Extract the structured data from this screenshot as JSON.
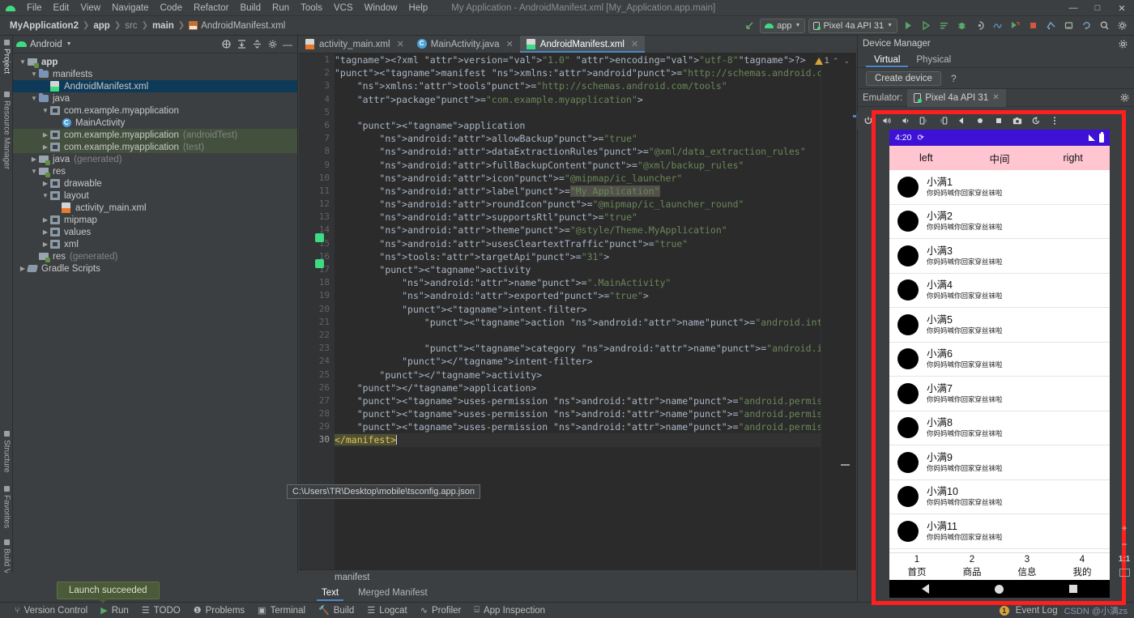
{
  "menubar": {
    "logo": "android-logo-icon",
    "items": [
      "File",
      "Edit",
      "View",
      "Navigate",
      "Code",
      "Refactor",
      "Build",
      "Run",
      "Tools",
      "VCS",
      "Window",
      "Help"
    ],
    "window_title": "My Application - AndroidManifest.xml [My_Application.app.main]",
    "controls": {
      "minimize": "—",
      "maximize": "□",
      "close": "✕"
    }
  },
  "toolbar": {
    "breadcrumbs": [
      "MyApplication2",
      "app",
      "src",
      "main",
      "AndroidManifest.xml"
    ],
    "back_icon": "back-arrow-icon",
    "module_selector": "app",
    "device_selector": "Pixel 4a API 31",
    "icons": [
      "run-icon",
      "debug-run-icon",
      "profile-icon",
      "debug-icon",
      "attach-debugger-icon",
      "profiler-icon",
      "run-external-icon",
      "stop-icon",
      "sdk-manager-icon",
      "avd-manager-icon",
      "sync-gradle-icon",
      "search-icon",
      "settings-icon"
    ]
  },
  "left_strip": {
    "top_labels": [
      "Project",
      "Resource Manager"
    ],
    "bottom_labels": [
      "Structure",
      "Favorites",
      "Build Variants"
    ]
  },
  "project_panel": {
    "title": "Android",
    "header_icons": [
      "select-opened-file-icon",
      "expand-all-icon",
      "collapse-all-icon",
      "settings-icon",
      "hide-icon"
    ],
    "tree": [
      {
        "label": "app",
        "indent": 0,
        "arrow": "v",
        "icon": "folder-module",
        "bold": true,
        "state": "normal",
        "suffix": ""
      },
      {
        "label": "manifests",
        "indent": 1,
        "arrow": "v",
        "icon": "folder",
        "bold": false,
        "state": "normal",
        "suffix": ""
      },
      {
        "label": "AndroidManifest.xml",
        "indent": 2,
        "arrow": "",
        "icon": "xml-green",
        "bold": false,
        "state": "selected",
        "suffix": ""
      },
      {
        "label": "java",
        "indent": 1,
        "arrow": "v",
        "icon": "folder",
        "bold": false,
        "state": "normal",
        "suffix": ""
      },
      {
        "label": "com.example.myapplication",
        "indent": 2,
        "arrow": "v",
        "icon": "package",
        "bold": false,
        "state": "normal",
        "suffix": ""
      },
      {
        "label": "MainActivity",
        "indent": 3,
        "arrow": "",
        "icon": "class",
        "bold": false,
        "state": "normal",
        "suffix": ""
      },
      {
        "label": "com.example.myapplication",
        "indent": 2,
        "arrow": ">",
        "icon": "package",
        "bold": false,
        "state": "green",
        "suffix": "(androidTest)"
      },
      {
        "label": "com.example.myapplication",
        "indent": 2,
        "arrow": ">",
        "icon": "package",
        "bold": false,
        "state": "green",
        "suffix": "(test)"
      },
      {
        "label": "java",
        "indent": 1,
        "arrow": ">",
        "icon": "folder-gen",
        "bold": false,
        "state": "normal",
        "suffix": "(generated)"
      },
      {
        "label": "res",
        "indent": 1,
        "arrow": "v",
        "icon": "folder-res",
        "bold": false,
        "state": "normal",
        "suffix": ""
      },
      {
        "label": "drawable",
        "indent": 2,
        "arrow": ">",
        "icon": "package",
        "bold": false,
        "state": "normal",
        "suffix": ""
      },
      {
        "label": "layout",
        "indent": 2,
        "arrow": "v",
        "icon": "package",
        "bold": false,
        "state": "normal",
        "suffix": ""
      },
      {
        "label": "activity_main.xml",
        "indent": 3,
        "arrow": "",
        "icon": "xml-layout",
        "bold": false,
        "state": "normal",
        "suffix": ""
      },
      {
        "label": "mipmap",
        "indent": 2,
        "arrow": ">",
        "icon": "package",
        "bold": false,
        "state": "normal",
        "suffix": ""
      },
      {
        "label": "values",
        "indent": 2,
        "arrow": ">",
        "icon": "package",
        "bold": false,
        "state": "normal",
        "suffix": ""
      },
      {
        "label": "xml",
        "indent": 2,
        "arrow": ">",
        "icon": "package",
        "bold": false,
        "state": "normal",
        "suffix": ""
      },
      {
        "label": "res",
        "indent": 1,
        "arrow": "",
        "icon": "folder-res",
        "bold": false,
        "state": "normal",
        "suffix": "(generated)"
      },
      {
        "label": "Gradle Scripts",
        "indent": 0,
        "arrow": ">",
        "icon": "gradle",
        "bold": false,
        "state": "normal",
        "suffix": ""
      }
    ]
  },
  "editor": {
    "tabs": [
      {
        "label": "activity_main.xml",
        "icon": "xml-layout-icon",
        "active": false
      },
      {
        "label": "MainActivity.java",
        "icon": "java-class-icon",
        "active": false
      },
      {
        "label": "AndroidManifest.xml",
        "icon": "xml-manifest-icon",
        "active": true
      }
    ],
    "warning_count": "1",
    "line_numbers": [
      "1",
      "2",
      "3",
      "4",
      "5",
      "6",
      "7",
      "8",
      "9",
      "10",
      "11",
      "12",
      "13",
      "14",
      "15",
      "16",
      "17",
      "18",
      "19",
      "20",
      "21",
      "22",
      "23",
      "24",
      "25",
      "26",
      "27",
      "28",
      "29",
      "30"
    ],
    "code_lines": [
      "<?xml version=\"1.0\" encoding=\"utf-8\"?>",
      "<manifest xmlns:android=\"http://schemas.android.com/apk/res/android\"",
      "    xmlns:tools=\"http://schemas.android.com/tools\"",
      "    package=\"com.example.myapplication\">",
      "",
      "    <application",
      "        android:allowBackup=\"true\"",
      "        android:dataExtractionRules=\"@xml/data_extraction_rules\"",
      "        android:fullBackupContent=\"@xml/backup_rules\"",
      "        android:icon=\"@mipmap/ic_launcher\"",
      "        android:label=\"My Application\"",
      "        android:roundIcon=\"@mipmap/ic_launcher_round\"",
      "        android:supportsRtl=\"true\"",
      "        android:theme=\"@style/Theme.MyApplication\"",
      "        android:usesCleartextTraffic=\"true\"",
      "        tools:targetApi=\"31\">",
      "        <activity",
      "            android:name=\".MainActivity\"",
      "            android:exported=\"true\">",
      "            <intent-filter>",
      "                <action android:name=\"android.intent.action.MAIN\" />",
      "",
      "                <category android:name=\"android.intent.category.LAUNCHER\" />",
      "            </intent-filter>",
      "        </activity>",
      "    </application>",
      "    <uses-permission android:name=\"android.permission.INTERNET\" />",
      "    <uses-permission android:name=\"android.permission.ACCESS_NETWORK_STATE\" />",
      "    <uses-permission android:name=\"android.permission.ACCESS_WIFI_STATE\" />",
      "</manifest>"
    ],
    "breadcrumb_bottom": "manifest",
    "view_tabs": [
      {
        "label": "Text",
        "active": true
      },
      {
        "label": "Merged Manifest",
        "active": false
      }
    ]
  },
  "overlays": {
    "path_tooltip": "C:\\Users\\TR\\Desktop\\mobile\\tsconfig.app.json",
    "launch_toast": "Launch succeeded"
  },
  "device_manager": {
    "title": "Device Manager",
    "settings_icon": "gear-icon",
    "tabs": [
      {
        "label": "Virtual",
        "active": true
      },
      {
        "label": "Physical",
        "active": false
      }
    ],
    "create_device_label": "Create device",
    "help_label": "?",
    "emulator_label": "Emulator:",
    "emulator_tab": "Pixel 4a API 31",
    "emulator_close": "✕",
    "emulator_toolbar_icons": [
      "power-icon",
      "volume-up-icon",
      "volume-down-icon",
      "rotate-left-icon",
      "rotate-right-icon",
      "back-icon",
      "home-icon",
      "overview-icon",
      "screenshot-icon",
      "restore-icon",
      "more-icon"
    ]
  },
  "emulator": {
    "status_bar": {
      "time": "4:20",
      "left_icon": "sync-icon",
      "signal_icon": "signal-icon",
      "battery_icon": "battery-icon"
    },
    "top_header": [
      "left",
      "中间",
      "right"
    ],
    "list_items": [
      {
        "title": "小满1",
        "subtitle": "你妈妈喊你回家穿丝袜啦"
      },
      {
        "title": "小满2",
        "subtitle": "你妈妈喊你回家穿丝袜啦"
      },
      {
        "title": "小满3",
        "subtitle": "你妈妈喊你回家穿丝袜啦"
      },
      {
        "title": "小满4",
        "subtitle": "你妈妈喊你回家穿丝袜啦"
      },
      {
        "title": "小满5",
        "subtitle": "你妈妈喊你回家穿丝袜啦"
      },
      {
        "title": "小满6",
        "subtitle": "你妈妈喊你回家穿丝袜啦"
      },
      {
        "title": "小满7",
        "subtitle": "你妈妈喊你回家穿丝袜啦"
      },
      {
        "title": "小满8",
        "subtitle": "你妈妈喊你回家穿丝袜啦"
      },
      {
        "title": "小满9",
        "subtitle": "你妈妈喊你回家穿丝袜啦"
      },
      {
        "title": "小满10",
        "subtitle": "你妈妈喊你回家穿丝袜啦"
      },
      {
        "title": "小满11",
        "subtitle": "你妈妈喊你回家穿丝袜啦"
      }
    ],
    "bottom_nav": [
      {
        "num": "1",
        "label": "首页"
      },
      {
        "num": "2",
        "label": "商品"
      },
      {
        "num": "3",
        "label": "信息"
      },
      {
        "num": "4",
        "label": "我的"
      }
    ],
    "system_nav": [
      "back-icon",
      "home-icon",
      "recents-icon"
    ]
  },
  "zoom_controls": {
    "zoom_in": "+",
    "zoom_out": "−",
    "actual_size": "1:1",
    "fit_icon": "fit-screen-icon"
  },
  "status_bar": {
    "items": [
      {
        "label": "Version Control",
        "icon": "branch-icon"
      },
      {
        "label": "Run",
        "icon": "run-icon"
      },
      {
        "label": "TODO",
        "icon": "todo-icon"
      },
      {
        "label": "Problems",
        "icon": "problems-icon"
      },
      {
        "label": "Terminal",
        "icon": "terminal-icon"
      },
      {
        "label": "Build",
        "icon": "build-icon"
      },
      {
        "label": "Logcat",
        "icon": "logcat-icon"
      },
      {
        "label": "Profiler",
        "icon": "profiler-icon"
      },
      {
        "label": "App Inspection",
        "icon": "app-inspection-icon"
      }
    ],
    "event_log": {
      "count": "1",
      "label": "Event Log"
    },
    "watermark": "CSDN @小满zs"
  },
  "colors": {
    "accent_blue": "#4a88c7",
    "highlight_red": "#ff1f1f",
    "status_purple": "#3d11d6",
    "header_pink": "#ffc6d2",
    "android_green": "#3ddc84",
    "selection_blue": "#0d3a58"
  }
}
